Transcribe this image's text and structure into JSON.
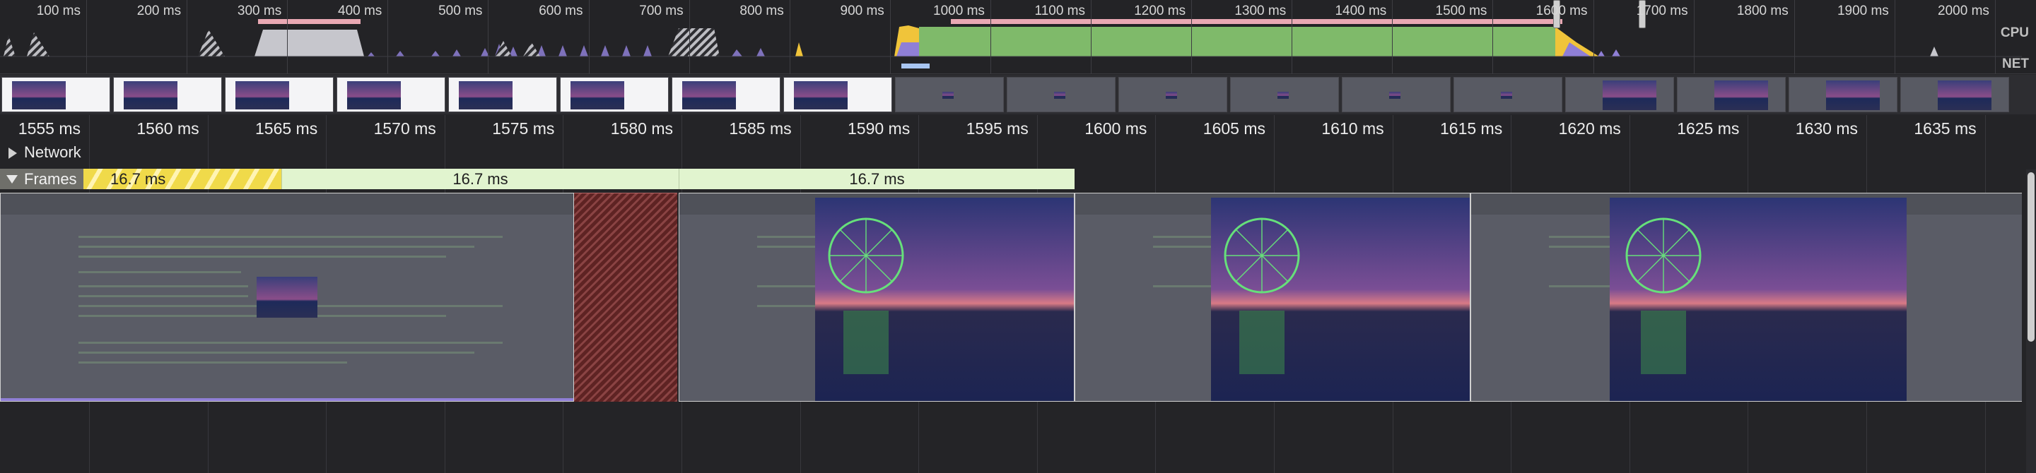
{
  "overview": {
    "ticks": [
      "100 ms",
      "200 ms",
      "300 ms",
      "400 ms",
      "500 ms",
      "600 ms",
      "700 ms",
      "800 ms",
      "900 ms",
      "1000 ms",
      "1100 ms",
      "1200 ms",
      "1300 ms",
      "1400 ms",
      "1500 ms",
      "1600 ms",
      "1700 ms",
      "1800 ms",
      "1900 ms",
      "2000 ms"
    ],
    "tick_label_overlap": "1600 ms",
    "cpu_label": "CPU",
    "net_label": "NET"
  },
  "ruler": {
    "labels": [
      "1555 ms",
      "1560 ms",
      "1565 ms",
      "1570 ms",
      "1575 ms",
      "1580 ms",
      "1585 ms",
      "1590 ms",
      "1595 ms",
      "1600 ms",
      "1605 ms",
      "1610 ms",
      "1615 ms",
      "1620 ms",
      "1625 ms",
      "1630 ms",
      "1635 ms"
    ]
  },
  "tracks": {
    "network_label": "Network",
    "frames_label": "Frames"
  },
  "frames": [
    {
      "duration": "16.7 ms",
      "status": "partially-presented",
      "color": "#f0da4a"
    },
    {
      "duration": "16.7 ms",
      "status": "presented",
      "color": "#e1f4cf"
    },
    {
      "duration": "16.7 ms",
      "status": "presented",
      "color": "#e1f4cf"
    }
  ],
  "colors": {
    "scripting": "#f0c43a",
    "rendering": "#8f7fd6",
    "painting": "#7fba6a",
    "idle_gray": "#c6c6cc",
    "dropped_frame": "#8a4343",
    "selection": "#e9a8b3"
  },
  "icons": {
    "expand_network": "triangle-right-icon",
    "collapse_frames": "triangle-down-icon"
  }
}
